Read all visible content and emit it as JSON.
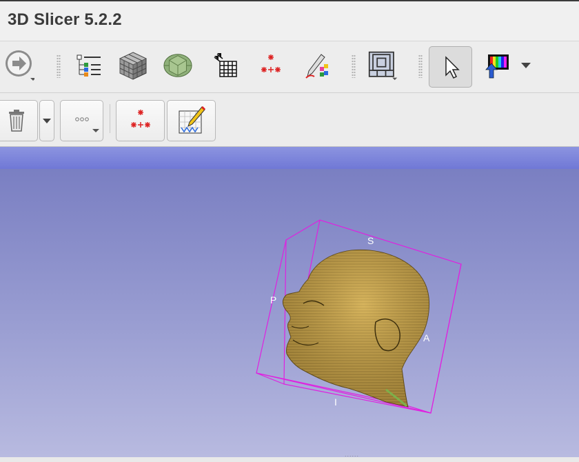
{
  "app": {
    "title": "3D Slicer 5.2.2"
  },
  "toolbar": {
    "overflow_label": "»",
    "items": [
      {
        "name": "module-navigation-icon"
      },
      {
        "name": "data-module-icon"
      },
      {
        "name": "volumes-module-icon"
      },
      {
        "name": "models-module-icon"
      },
      {
        "name": "transforms-module-icon"
      },
      {
        "name": "markups-module-icon"
      },
      {
        "name": "segment-editor-icon"
      },
      {
        "name": "layout-icon"
      },
      {
        "name": "pointer-mode-icon"
      },
      {
        "name": "window-level-icon"
      }
    ]
  },
  "secondary_toolbar": {
    "items": [
      {
        "name": "delete-icon"
      },
      {
        "name": "more-options-icon"
      },
      {
        "name": "place-fiducial-icon"
      },
      {
        "name": "annotation-edit-icon"
      }
    ]
  },
  "viewport": {
    "orientation_labels": {
      "superior": "S",
      "posterior": "P",
      "anterior": "A",
      "inferior": "I"
    },
    "box_color": "#e020e0",
    "model_color": "#c9a54e",
    "background_top": "#7a7fc2",
    "background_bottom": "#b8bae0"
  },
  "bottom_handle": "......"
}
